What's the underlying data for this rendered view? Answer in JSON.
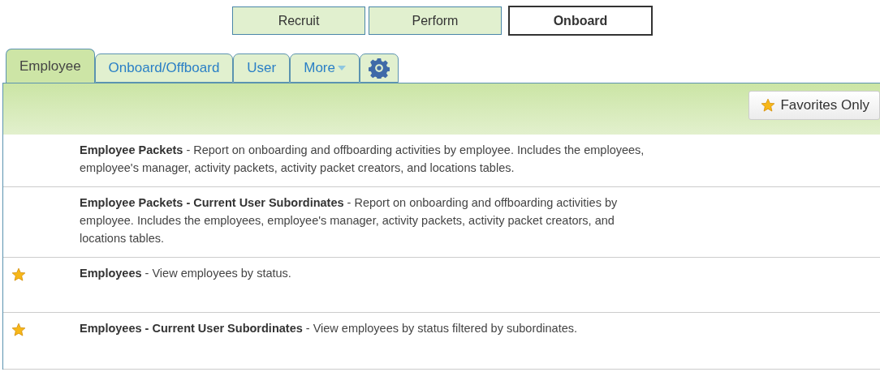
{
  "modules": [
    {
      "label": "Recruit",
      "selected": false
    },
    {
      "label": "Perform",
      "selected": false
    },
    {
      "label": "Onboard",
      "selected": true
    }
  ],
  "tabs": [
    {
      "kind": "text",
      "label": "Employee",
      "selected": true
    },
    {
      "kind": "text",
      "label": "Onboard/Offboard",
      "selected": false
    },
    {
      "kind": "text",
      "label": "User",
      "selected": false
    },
    {
      "kind": "menu",
      "label": "More",
      "selected": false
    },
    {
      "kind": "settings",
      "selected": false
    }
  ],
  "toolbar": {
    "favorites_button": "Favorites Only"
  },
  "reports": [
    {
      "favorite": false,
      "text": "**Employee Packets** - Report on onboarding and offboarding activities by employee. Includes the employees, employee's manager, activity packets, activity packet creators, and locations tables."
    },
    {
      "favorite": false,
      "text": "**Employee Packets - Current User Subordinates** - Report on onboarding and offboarding activities by employee. Includes the employees, employee's manager, activity packets, activity packet creators, and locations tables."
    },
    {
      "favorite": true,
      "text": "**Employees** - View employees by status."
    },
    {
      "favorite": true,
      "text": "**Employees - Current User Subordinates** - View employees by status filtered by subordinates."
    }
  ]
}
